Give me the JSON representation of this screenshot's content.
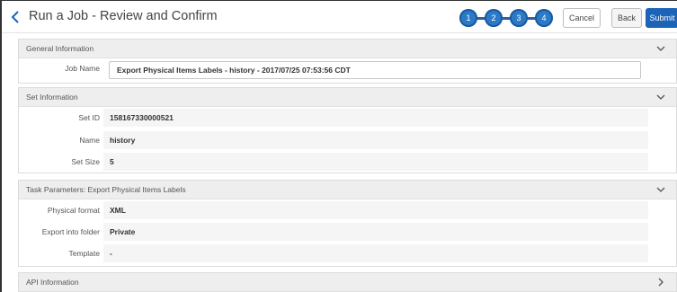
{
  "header": {
    "title": "Run a Job - Review and Confirm",
    "steps": [
      "1",
      "2",
      "3",
      "4"
    ],
    "cancel_label": "Cancel",
    "back_label": "Back",
    "submit_label": "Submit"
  },
  "general": {
    "title": "General Information",
    "job_name_label": "Job Name",
    "job_name_value": "Export Physical Items Labels - history - 2017/07/25 07:53:56 CDT"
  },
  "set_info": {
    "title": "Set Information",
    "rows": [
      {
        "label": "Set ID",
        "value": "158167330000521"
      },
      {
        "label": "Name",
        "value": "history"
      },
      {
        "label": "Set Size",
        "value": "5"
      }
    ]
  },
  "task": {
    "title": "Task Parameters: Export Physical Items Labels",
    "rows": [
      {
        "label": "Physical format",
        "value": "XML"
      },
      {
        "label": "Export into folder",
        "value": "Private"
      },
      {
        "label": "Template",
        "value": "-"
      }
    ]
  },
  "api": {
    "title": "API Information"
  },
  "colors": {
    "accent": "#1c64b8",
    "step": "#2b7ac8"
  }
}
